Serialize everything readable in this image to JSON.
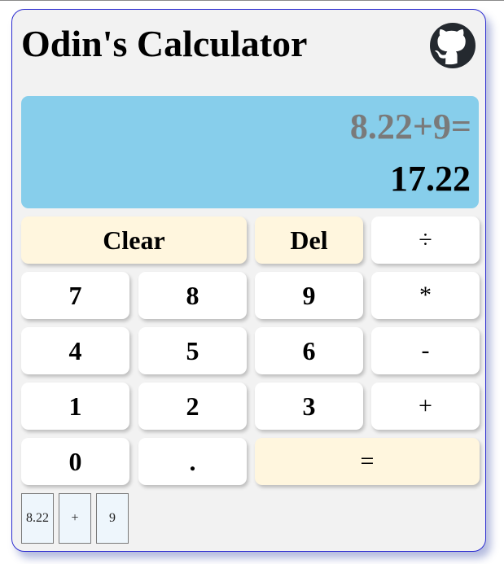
{
  "app": {
    "title": "Odin's Calculator",
    "github_icon": "github-icon"
  },
  "display": {
    "expression": "8.22+9=",
    "result": "17.22"
  },
  "keys": {
    "clear": "Clear",
    "del": "Del",
    "divide": "÷",
    "seven": "7",
    "eight": "8",
    "nine": "9",
    "multiply": "*",
    "four": "4",
    "five": "5",
    "six": "6",
    "subtract": "-",
    "one": "1",
    "two": "2",
    "three": "3",
    "add": "+",
    "zero": "0",
    "decimal": ".",
    "equals": "="
  },
  "history": [
    "8.22",
    "+",
    "9"
  ],
  "colors": {
    "panel_background": "#f2f2f2",
    "panel_border": "#2c2cd0",
    "display_background": "#87ceeb",
    "expression_text": "#7a7a7a",
    "key_background": "#ffffff",
    "accent_key_background": "#fff6de",
    "history_chip_background": "#eef6fc"
  }
}
